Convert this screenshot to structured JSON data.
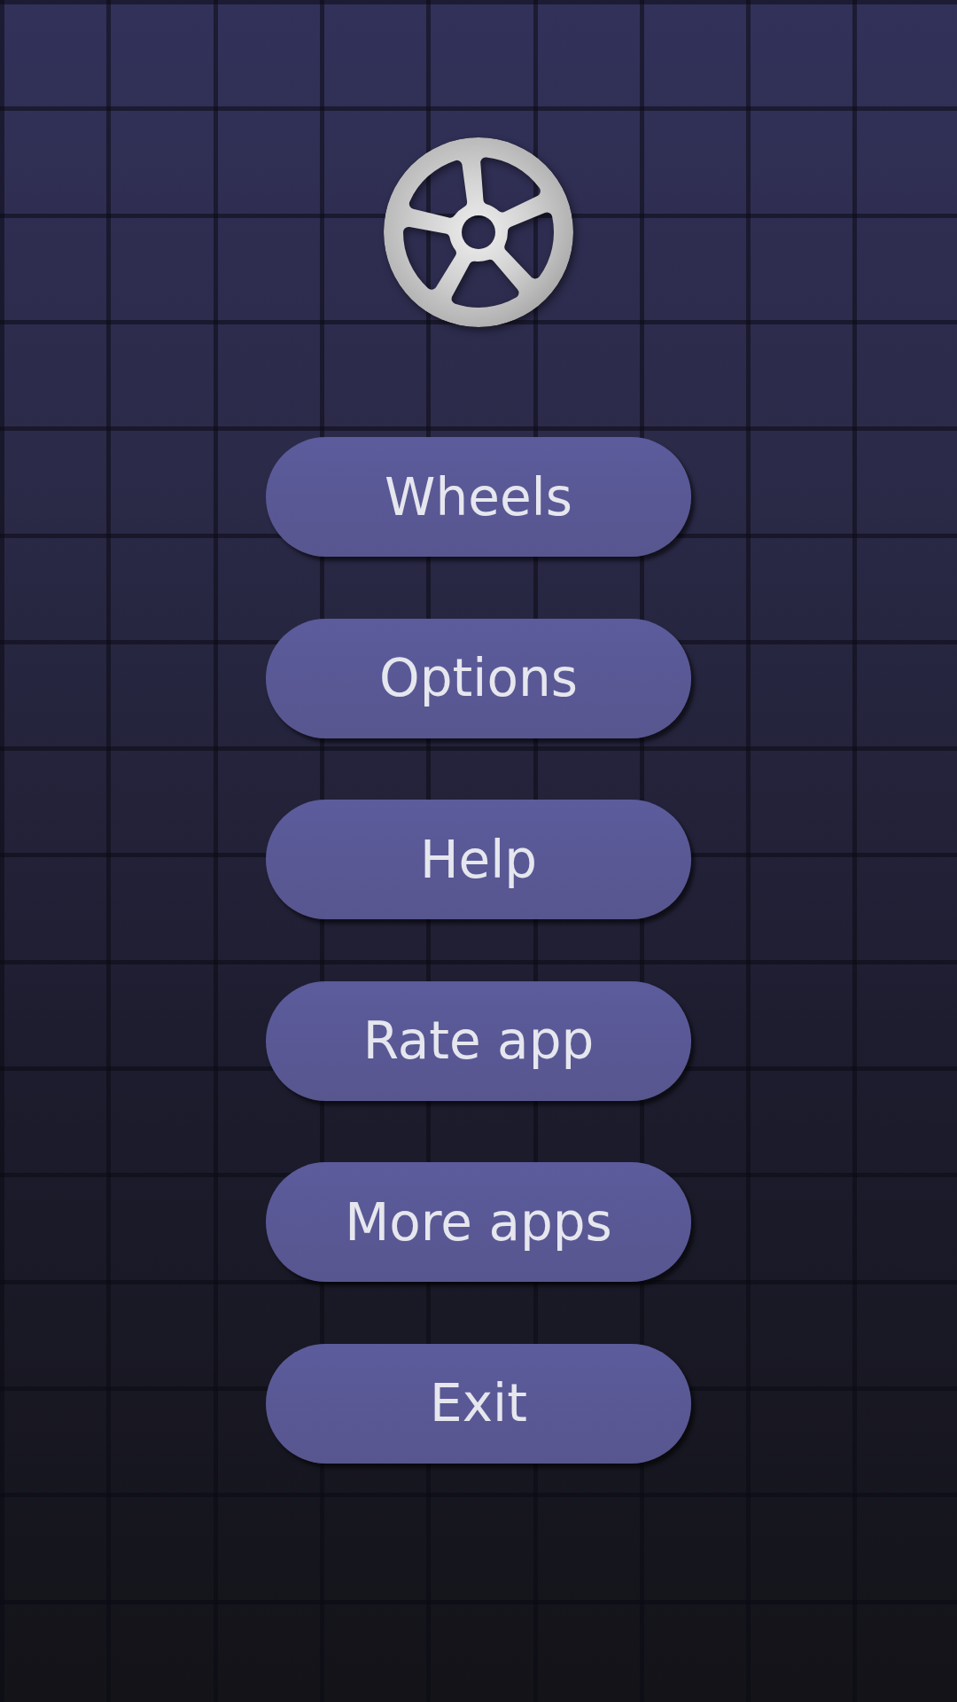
{
  "menu_buttons": [
    "Wheels",
    "Options",
    "Help",
    "Rate app",
    "More apps",
    "Exit"
  ]
}
